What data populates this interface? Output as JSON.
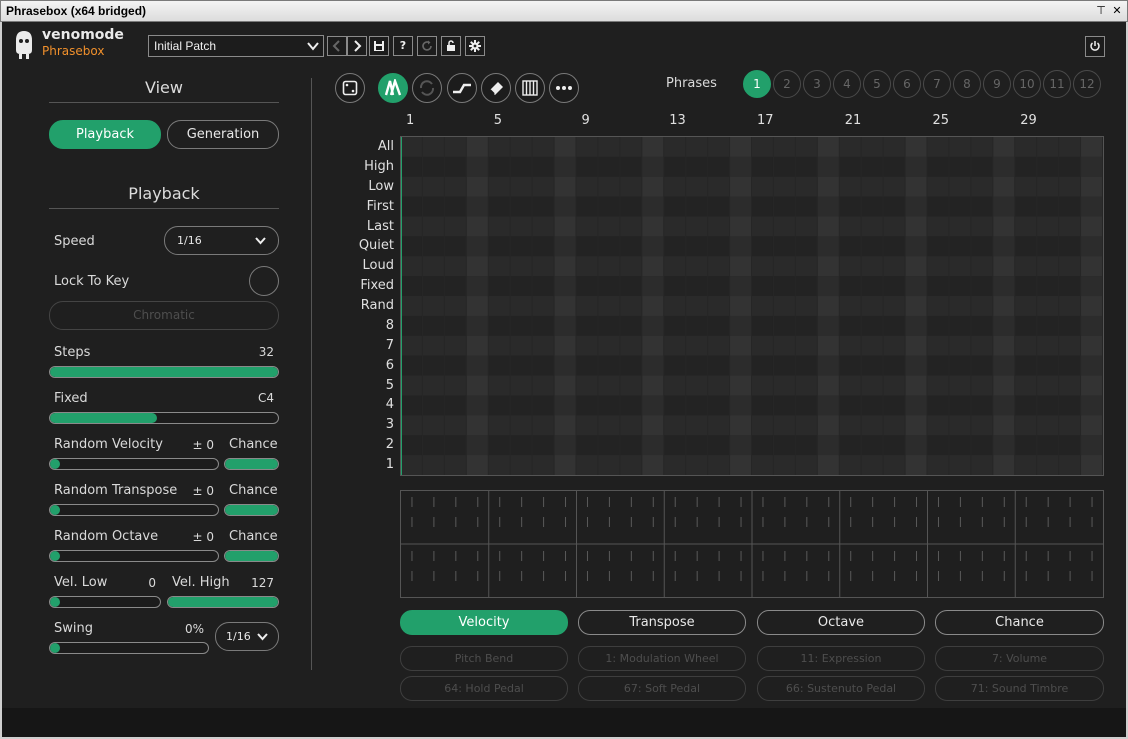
{
  "window": {
    "title": "Phrasebox (x64 bridged)",
    "pin_glyph": "⊤",
    "close_glyph": "✕"
  },
  "header": {
    "brand": "venomode",
    "product": "Phrasebox",
    "patch_name": "Initial Patch",
    "icons": [
      "chevron-left-icon",
      "chevron-right-icon",
      "save-icon",
      "help-icon",
      "refresh-icon",
      "lock-icon",
      "settings-icon"
    ],
    "help_label": "?",
    "power_icon": "power-icon"
  },
  "sidebar": {
    "view_title": "View",
    "view_tabs": [
      {
        "label": "Playback",
        "active": true
      },
      {
        "label": "Generation",
        "active": false
      }
    ],
    "playback_title": "Playback",
    "speed": {
      "label": "Speed",
      "value": "1/16"
    },
    "lock_to_key": {
      "label": "Lock To Key",
      "enabled": false
    },
    "scale": {
      "label": "Chromatic"
    },
    "steps": {
      "label": "Steps",
      "value": "32",
      "level": 1.0
    },
    "fixed": {
      "label": "Fixed",
      "value": "C4",
      "level": 0.47
    },
    "random_velocity": {
      "label": "Random Velocity",
      "value": "± 0",
      "chance_label": "Chance",
      "level": 0.0,
      "chance_level": 1.0
    },
    "random_transpose": {
      "label": "Random Transpose",
      "value": "± 0",
      "chance_label": "Chance",
      "level": 0.0,
      "chance_level": 1.0
    },
    "random_octave": {
      "label": "Random Octave",
      "value": "± 0",
      "chance_label": "Chance",
      "level": 0.0,
      "chance_level": 1.0
    },
    "vel_low": {
      "label": "Vel. Low",
      "value": "0",
      "level": 0.0
    },
    "vel_high": {
      "label": "Vel. High",
      "value": "127",
      "level": 1.0
    },
    "swing": {
      "label": "Swing",
      "value": "0%",
      "level": 0.0,
      "rate": "1/16"
    }
  },
  "toolbar": {
    "tools": [
      "dice-icon",
      "velocity-shape-icon",
      "loop-icon",
      "legato-icon",
      "eraser-icon",
      "keyboard-icon",
      "more-icon"
    ],
    "phrases_label": "Phrases",
    "phrases": [
      "1",
      "2",
      "3",
      "4",
      "5",
      "6",
      "7",
      "8",
      "9",
      "10",
      "11",
      "12"
    ],
    "active_phrase": "1"
  },
  "grid": {
    "column_markers": [
      "1",
      "5",
      "9",
      "13",
      "17",
      "21",
      "25",
      "29"
    ],
    "row_labels": [
      "All",
      "High",
      "Low",
      "First",
      "Last",
      "Quiet",
      "Loud",
      "Fixed",
      "Rand",
      "8",
      "7",
      "6",
      "5",
      "4",
      "3",
      "2",
      "1"
    ],
    "steps": 32
  },
  "modulation": {
    "tabs": [
      {
        "label": "Velocity",
        "active": true
      },
      {
        "label": "Transpose",
        "active": false
      },
      {
        "label": "Octave",
        "active": false
      },
      {
        "label": "Chance",
        "active": false
      }
    ],
    "cc_row1": [
      "Pitch Bend",
      "1: Modulation Wheel",
      "11: Expression",
      "7: Volume"
    ],
    "cc_row2": [
      "64: Hold Pedal",
      "67: Soft Pedal",
      "66: Sustenuto Pedal",
      "71: Sound Timbre"
    ]
  },
  "colors": {
    "accent": "#22a06b",
    "logo_orange": "#f0902c",
    "background": "#1f1f1f"
  }
}
